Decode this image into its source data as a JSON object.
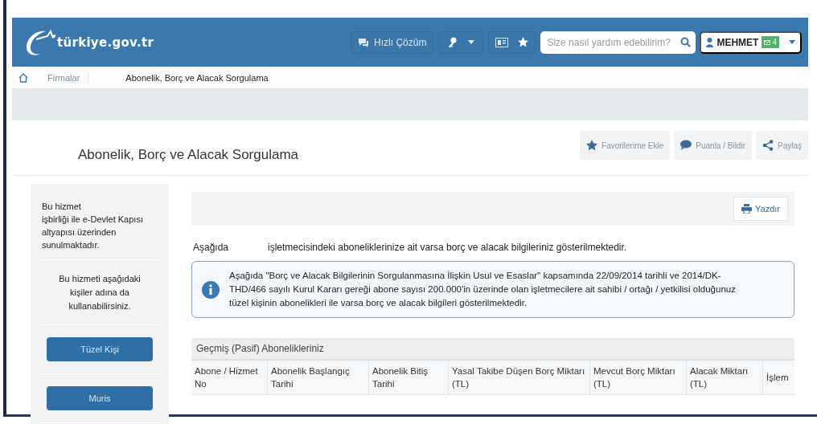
{
  "header": {
    "logo": "türkiye.gov.tr",
    "quick_solution": "Hızlı Çözüm",
    "search": {
      "placeholder": "Size nasıl yardım edebilirim?"
    },
    "user": {
      "name": "MEHMET",
      "badge": "4"
    }
  },
  "breadcrumb": [
    "Firmalar",
    "Abonelik, Borç ve Alacak Sorgulama"
  ],
  "page_title": "Abonelik, Borç ve Alacak Sorgulama",
  "actions": [
    "Favorilerime Ekle",
    "Puanla / Bildir",
    "Paylaş"
  ],
  "sidebar": {
    "provider_lead": "Bu hizmet",
    "provider_text": "işbirliği ile e-Devlet Kapısı altyapısı üzerinden sunulmaktadır.",
    "on_behalf": "Bu hizmeti aşağıdaki kişiler adına da kullanabilirsiniz.",
    "buttons": [
      "Tüzel Kişi",
      "Muris"
    ]
  },
  "main": {
    "print_button": "Yazdır",
    "intro_lead": "Aşağıda",
    "intro_text": "işletmecisindeki aboneliklerinize ait varsa borç ve alacak bilgileriniz gösterilmektedir.",
    "info": "Aşağıda \"Borç ve Alacak Bilgilerinin Sorgulanmasına İlişkin Usul ve Esaslar\" kapsamında 22/09/2014 tarihli ve 2014/DK-THD/466 sayılı Kurul Kararı gereği abone sayısı 200.000'in üzerinde olan işletmecilere ait sahibi / ortağı / yetkilisi olduğunuz tüzel kişinin abonelikleri ile varsa borç ve alacak bilgileri gösterilmektedir.",
    "table": {
      "title": "Geçmiş (Pasif) Abonelikleriniz",
      "columns": [
        "Abone / Hizmet No",
        "Abonelik Başlangıç Tarihi",
        "Abonelik Bitiş Tarihi",
        "Yasal Takibe Düşen Borç Miktarı (TL)",
        "Mevcut Borç Miktarı (TL)",
        "Alacak Miktarı (TL)",
        "İşlem"
      ]
    }
  }
}
